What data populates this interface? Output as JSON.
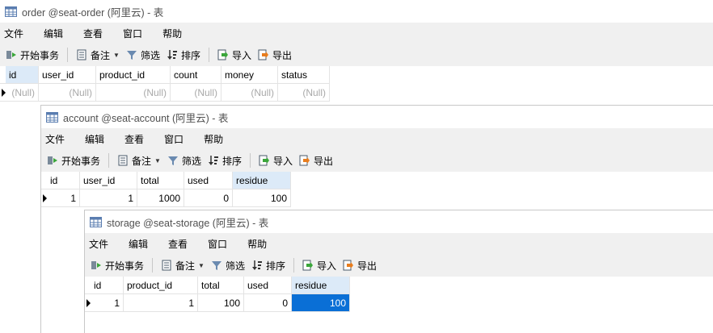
{
  "windows": [
    {
      "title": "order @seat-order (阿里云) - 表",
      "menu": [
        "文件",
        "编辑",
        "查看",
        "窗口",
        "帮助"
      ],
      "toolbar": {
        "begin": "开始事务",
        "memo": "备注",
        "filter": "筛选",
        "sort": "排序",
        "import": "导入",
        "export": "导出"
      },
      "columns": [
        "id",
        "user_id",
        "product_id",
        "count",
        "money",
        "status"
      ],
      "rows": [
        [
          "(Null)",
          "(Null)",
          "(Null)",
          "(Null)",
          "(Null)",
          "(Null)"
        ]
      ]
    },
    {
      "title": "account @seat-account (阿里云) - 表",
      "menu": [
        "文件",
        "编辑",
        "查看",
        "窗口",
        "帮助"
      ],
      "toolbar": {
        "begin": "开始事务",
        "memo": "备注",
        "filter": "筛选",
        "sort": "排序",
        "import": "导入",
        "export": "导出"
      },
      "columns": [
        "id",
        "user_id",
        "total",
        "used",
        "residue"
      ],
      "rows": [
        [
          "1",
          "1",
          "1000",
          "0",
          "100"
        ]
      ]
    },
    {
      "title": "storage @seat-storage (阿里云) - 表",
      "menu": [
        "文件",
        "编辑",
        "查看",
        "窗口",
        "帮助"
      ],
      "toolbar": {
        "begin": "开始事务",
        "memo": "备注",
        "filter": "筛选",
        "sort": "排序",
        "import": "导入",
        "export": "导出"
      },
      "columns": [
        "id",
        "product_id",
        "total",
        "used",
        "residue"
      ],
      "rows": [
        [
          "1",
          "1",
          "100",
          "0",
          "100"
        ]
      ]
    }
  ],
  "colors": {
    "selected_cell": "#0a6fd6",
    "highlight_header": "#dceaf8",
    "null_text": "#a9a9a9"
  },
  "icons": [
    "table-icon",
    "begin-transaction-icon",
    "memo-icon",
    "filter-icon",
    "sort-icon",
    "import-icon",
    "export-icon"
  ]
}
